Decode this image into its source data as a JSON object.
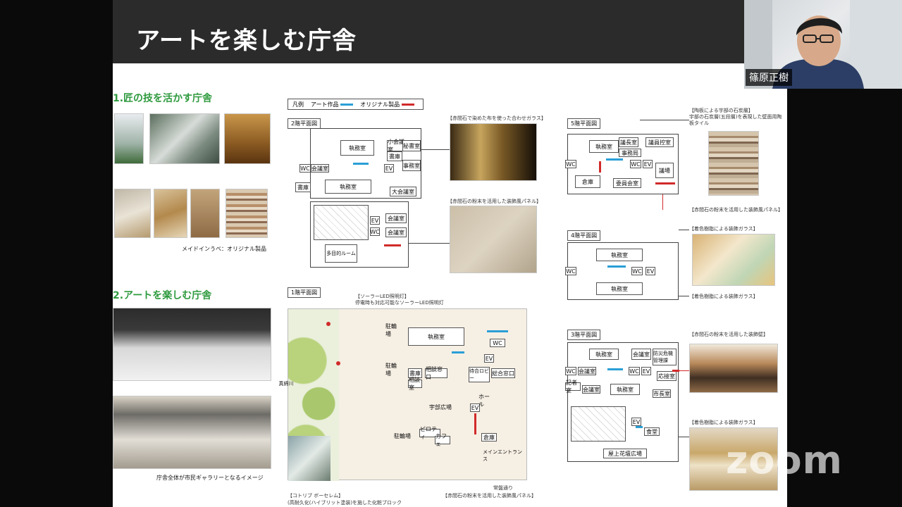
{
  "slide": {
    "title": "アートを楽しむ庁舎",
    "section1": {
      "heading": "1.匠の技を活かす庁舎",
      "caption": "メイドインうべ：オリジナル製品"
    },
    "section2": {
      "heading": "2.アートを楽しむ庁舎",
      "caption": "庁舎全体が市民ギャラリーとなるイメージ"
    },
    "legend": {
      "label": "凡例",
      "art": "アート作品",
      "original": "オリジナル製品"
    },
    "floor2": {
      "label": "2階平面図",
      "rooms": [
        "執務室",
        "小会議室",
        "秘書室",
        "書庫",
        "事務室",
        "WC",
        "会議室",
        "EV",
        "書庫",
        "執務室",
        "大会議室",
        "会議室",
        "EV",
        "WC",
        "会議室",
        "多目的ルーム"
      ],
      "note_glass": "【赤間石で染めた布を使った合わせガラス】",
      "note_panel": "【赤間石の粉末を活用した装飾風パネル】"
    },
    "floor1": {
      "label": "1階平面図",
      "note_solar_title": "【ソーラーLED照明灯】",
      "note_solar_desc": "停電時も対応可能なソーラーLED照明灯",
      "rooms": [
        "駐輪場",
        "執務室",
        "WC",
        "EV",
        "駐輪場",
        "書庫",
        "相談窓口",
        "待合ロビー",
        "総合窓口",
        "相談室",
        "宇部広場",
        "EV",
        "ホール",
        "駐輪場",
        "ピロティ",
        "カフェ",
        "倉庫",
        "メインエントランス"
      ],
      "river": "真締川",
      "note_block_title": "【コトリブ ボーセレム】",
      "note_block_desc": "(高耐久化(ハイブリット塗装)を施した化粧ブロック",
      "note_panel": "【赤間石の粉末を活用した装飾風パネル】",
      "road": "常盤通り"
    },
    "floor5": {
      "label": "5階平面図",
      "rooms": [
        "執務室",
        "議長室",
        "議員控室",
        "WC",
        "事務局",
        "WC",
        "EV",
        "議場",
        "倉庫",
        "委員会室"
      ],
      "note_tile_title": "【陶板による宇部の石炭層】",
      "note_tile_desc": "宇部の石炭層(五段層)を表現した壁面用陶板タイル",
      "note_panel": "【赤間石の粉末を活用した装飾風パネル】"
    },
    "floor4": {
      "label": "4階平面図",
      "rooms": [
        "執務室",
        "WC",
        "WC",
        "EV",
        "執務室"
      ],
      "note_glass_a": "【着色樹脂による装飾ガラス】",
      "note_glass_b": "【着色樹脂による装飾ガラス】"
    },
    "floor3": {
      "label": "3階平面図",
      "rooms": [
        "執務室",
        "会議室",
        "防災危機管理課",
        "WC",
        "会議室",
        "WC",
        "EV",
        "応接室",
        "記者室",
        "会議室",
        "執務室",
        "市長室",
        "EV",
        "食堂",
        "屋上花壇広場"
      ],
      "note_wall": "【赤間石の粉末を活用した装飾壁】",
      "note_glass": "【着色樹脂による装飾ガラス】"
    }
  },
  "participant": {
    "name": "篠原正樹"
  },
  "watermark": "zoom",
  "colors": {
    "header_bg": "#2b2b2b",
    "heading_green": "#2e9a3e",
    "art_blue": "#2a9fd6",
    "original_red": "#d12a2a"
  }
}
